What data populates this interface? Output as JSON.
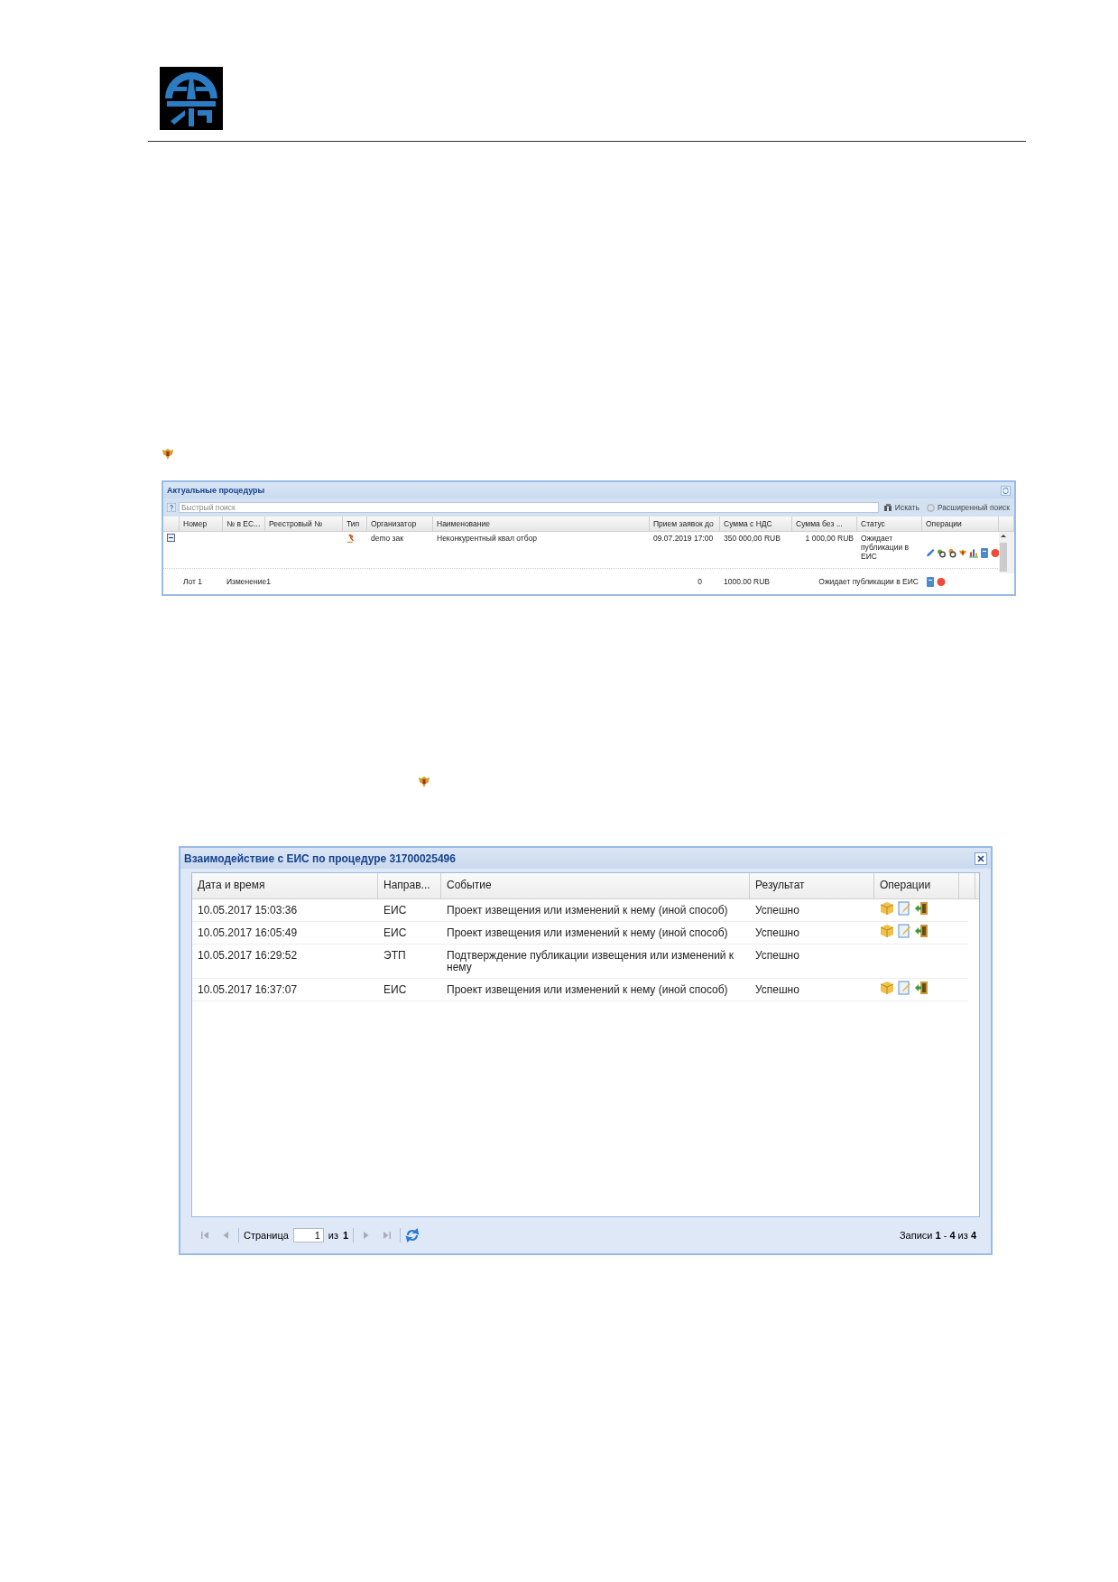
{
  "procedures_panel": {
    "title": "Актуальные процедуры",
    "search": {
      "placeholder": "Быстрый поиск"
    },
    "search_button": "Искать",
    "advanced_search": "Расширенный поиск",
    "columns": [
      "Номер",
      "№ в ЕС...",
      "Реестровый №",
      "Тип",
      "Организатор",
      "Наименование",
      "Прием заявок до",
      "Сумма с НДС",
      "Сумма без ...",
      "Статус",
      "Операции"
    ],
    "procedure": {
      "expanded": true,
      "organizer": "demo зак",
      "name": "Неконкурентный квал отбор",
      "deadline": "09.07.2019 17:00",
      "sum_vat": "350 000,00 RUB",
      "sum_no_vat": "1 000,00 RUB",
      "status": "Ожидает публикации в ЕИС"
    },
    "lot": {
      "number": "Лот 1",
      "change": "Изменение1",
      "count": "0",
      "sum": "1000.00 RUB",
      "status": "Ожидает публикации в ЕИС"
    }
  },
  "eis_window": {
    "title": "Взаимодействие с ЕИС по процедуре 31700025496",
    "columns": [
      "Дата и время",
      "Направ...",
      "Событие",
      "Результат",
      "Операции"
    ],
    "rows": [
      {
        "datetime": "10.05.2017 15:03:36",
        "direction": "ЕИС",
        "event": "Проект извещения или изменений к нему (иной способ)",
        "result": "Успешно",
        "has_operations": true
      },
      {
        "datetime": "10.05.2017 16:05:49",
        "direction": "ЕИС",
        "event": "Проект извещения или изменений к нему (иной способ)",
        "result": "Успешно",
        "has_operations": true
      },
      {
        "datetime": "10.05.2017 16:29:52",
        "direction": "ЭТП",
        "event": "Подтверждение публикации извещения или изменений к нему",
        "result": "Успешно",
        "has_operations": false
      },
      {
        "datetime": "10.05.2017 16:37:07",
        "direction": "ЕИС",
        "event": "Проект извещения или изменений к нему (иной способ)",
        "result": "Успешно",
        "has_operations": true
      }
    ],
    "paging": {
      "page_label": "Страница",
      "page": "1",
      "of_label": "из",
      "total_pages": "1",
      "records": "Записи **1** - **4** из **4**"
    }
  }
}
